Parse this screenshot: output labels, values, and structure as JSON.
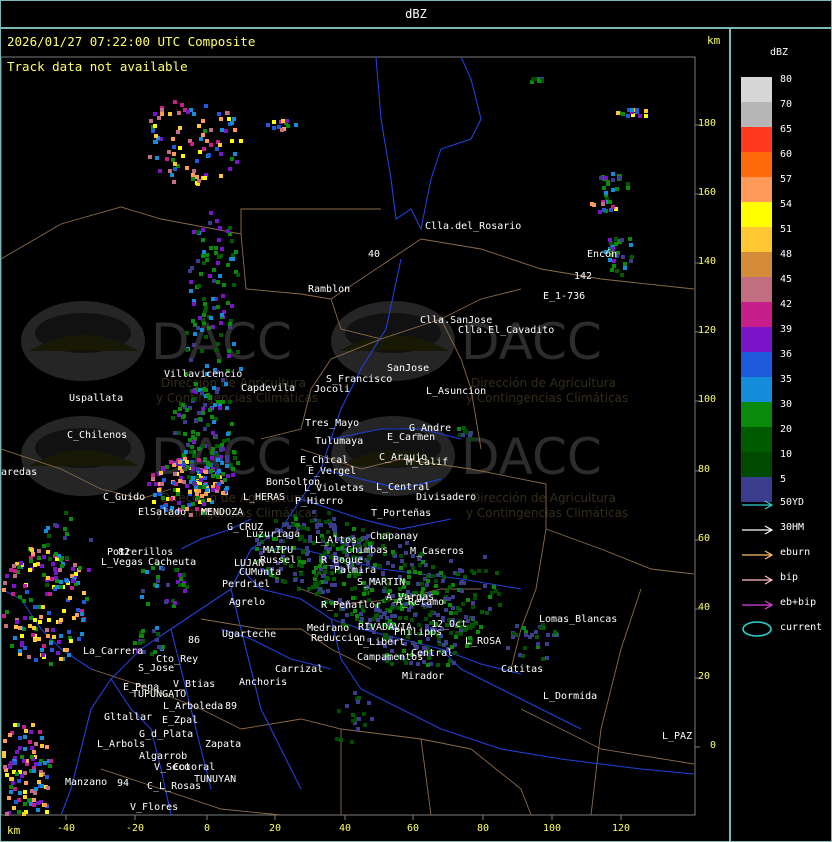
{
  "title": "dBZ",
  "header": {
    "time_label": "2026/01/27 07:22:00 UTC Composite",
    "track_label": "Track data not available",
    "km_top": "km",
    "km_bottom": "km"
  },
  "y_ticks": [
    "180",
    "160",
    "140",
    "120",
    "100",
    "80",
    "60",
    "40",
    "20",
    "0"
  ],
  "x_ticks": [
    "-40",
    "-20",
    "0",
    "20",
    "40",
    "60",
    "80",
    "100",
    "120"
  ],
  "legend": {
    "title": "dBZ",
    "levels": [
      {
        "value": "80",
        "color": "#d6d6d6"
      },
      {
        "value": "70",
        "color": "#b6b6b6"
      },
      {
        "value": "65",
        "color": "#ff3a1e"
      },
      {
        "value": "60",
        "color": "#ff6a0a"
      },
      {
        "value": "57",
        "color": "#ff9a5a"
      },
      {
        "value": "54",
        "color": "#ffff00"
      },
      {
        "value": "51",
        "color": "#ffc832"
      },
      {
        "value": "48",
        "color": "#d48c38"
      },
      {
        "value": "45",
        "color": "#c06e80"
      },
      {
        "value": "42",
        "color": "#c81e8c"
      },
      {
        "value": "39",
        "color": "#7a14c8"
      },
      {
        "value": "36",
        "color": "#1e5adc"
      },
      {
        "value": "35",
        "color": "#148cdc"
      },
      {
        "value": "30",
        "color": "#0a8a0a"
      },
      {
        "value": "20",
        "color": "#005a00"
      },
      {
        "value": "10",
        "color": "#004a00"
      },
      {
        "value": "5",
        "color": "#3c3c8c"
      }
    ],
    "tracks": [
      {
        "label": "50YD",
        "color": "#30d0d0",
        "shape": "arrow"
      },
      {
        "label": "30HM",
        "color": "#ffffff",
        "shape": "arrow"
      },
      {
        "label": "eburn",
        "color": "#ffc070",
        "shape": "arrow"
      },
      {
        "label": "bip",
        "color": "#ffc0c8",
        "shape": "arrow"
      },
      {
        "label": "eb+bip",
        "color": "#e040e0",
        "shape": "arrow"
      },
      {
        "label": "current",
        "color": "#30d0d0",
        "shape": "ellipse"
      }
    ]
  },
  "watermark": {
    "logo_text": "DACC",
    "line1": "Dirección de Agricultura",
    "line2": "y Contingencias Climáticas"
  },
  "places": [
    {
      "name": "Clla.del_Rosario"
    },
    {
      "name": "Encón"
    },
    {
      "name": "E_1-736"
    },
    {
      "name": "Ramblon"
    },
    {
      "name": "Clla.SanJose"
    },
    {
      "name": "Clla.El_Cavadito"
    },
    {
      "name": "SanJose"
    },
    {
      "name": "S_Francisco"
    },
    {
      "name": "Jocoli"
    },
    {
      "name": "L_Asuncion"
    },
    {
      "name": "Villavicencio"
    },
    {
      "name": "Capdevila"
    },
    {
      "name": "Uspallata"
    },
    {
      "name": "Tres_Mayo"
    },
    {
      "name": "Tulumaya"
    },
    {
      "name": "G_Andre"
    },
    {
      "name": "E_Carmen"
    },
    {
      "name": "C_Chilenos"
    },
    {
      "name": "E_Chical"
    },
    {
      "name": "E_Vergel"
    },
    {
      "name": "C_Araujo"
    },
    {
      "name": "M_Calif"
    },
    {
      "name": "aredas"
    },
    {
      "name": "BonSolton"
    },
    {
      "name": "L_Violetas"
    },
    {
      "name": "L_Central"
    },
    {
      "name": "L_HERAS"
    },
    {
      "name": "P_Hierro"
    },
    {
      "name": "Divisadero"
    },
    {
      "name": "C_Guido"
    },
    {
      "name": "ElSalado"
    },
    {
      "name": "MENDOZA"
    },
    {
      "name": "T_Porteñas"
    },
    {
      "name": "G_CRUZ"
    },
    {
      "name": "Luzuriaga"
    },
    {
      "name": "L_Altos"
    },
    {
      "name": "Chapanay"
    },
    {
      "name": "MAIPU"
    },
    {
      "name": "Russel"
    },
    {
      "name": "Chimbas"
    },
    {
      "name": "M_Caseros"
    },
    {
      "name": "Potrerillos"
    },
    {
      "name": "Cacheuta"
    },
    {
      "name": "L_Vegas"
    },
    {
      "name": "LUJAN"
    },
    {
      "name": "CUMunta"
    },
    {
      "name": "R_Bogue"
    },
    {
      "name": "Palmira"
    },
    {
      "name": "Perdriel"
    },
    {
      "name": "S_MARTIN"
    },
    {
      "name": "A_Vargas"
    },
    {
      "name": "Agrelo"
    },
    {
      "name": "R_Peñaflor"
    },
    {
      "name": "A_Retamo"
    },
    {
      "name": "12_Oct"
    },
    {
      "name": "Lomas_Blancas"
    },
    {
      "name": "Ugarteche"
    },
    {
      "name": "Medrano"
    },
    {
      "name": "RIVADAVIA"
    },
    {
      "name": "Philipps"
    },
    {
      "name": "Reduccion"
    },
    {
      "name": "L_Libert"
    },
    {
      "name": "Campamentos"
    },
    {
      "name": "Central"
    },
    {
      "name": "L_ROSA"
    },
    {
      "name": "La_Carrera"
    },
    {
      "name": "Cto_Rey"
    },
    {
      "name": "S_Jose"
    },
    {
      "name": "Carrizal"
    },
    {
      "name": "Catitas"
    },
    {
      "name": "Anchoris"
    },
    {
      "name": "E_Pena"
    },
    {
      "name": "TUPUNGATO"
    },
    {
      "name": "V_Btias"
    },
    {
      "name": "Mirador"
    },
    {
      "name": "L_Arboleda"
    },
    {
      "name": "L_Dormida"
    },
    {
      "name": "Gltallar"
    },
    {
      "name": "E_Zpal"
    },
    {
      "name": "G_d_Plata"
    },
    {
      "name": "L_Arbols"
    },
    {
      "name": "Zapata"
    },
    {
      "name": "L_PAZ"
    },
    {
      "name": "Algarrob"
    },
    {
      "name": "V_Seco"
    },
    {
      "name": "Cotoral"
    },
    {
      "name": "TUNUYAN"
    },
    {
      "name": "Manzano"
    },
    {
      "name": "C_L_Rosas"
    },
    {
      "name": "V_Flores"
    },
    {
      "name": "142"
    },
    {
      "name": "40"
    },
    {
      "name": "82"
    },
    {
      "name": "86"
    },
    {
      "name": "89"
    },
    {
      "name": "94"
    }
  ]
}
